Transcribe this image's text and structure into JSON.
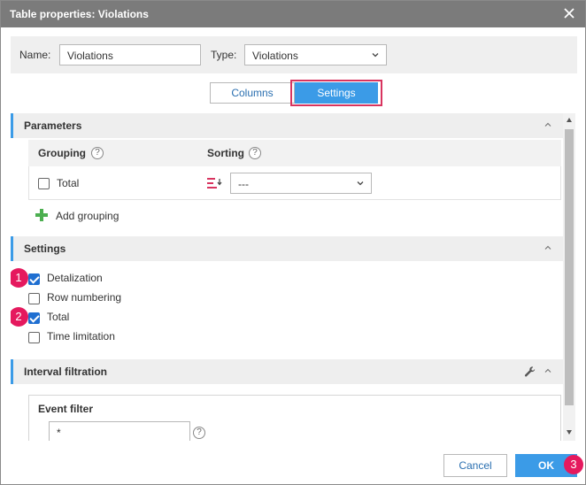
{
  "window": {
    "title": "Table properties: Violations"
  },
  "name_bar": {
    "name_label": "Name:",
    "name_value": "Violations",
    "type_label": "Type:",
    "type_value": "Violations"
  },
  "tabs": [
    {
      "label": "Columns",
      "active": false
    },
    {
      "label": "Settings",
      "active": true
    }
  ],
  "parameters": {
    "title": "Parameters",
    "grouping_header": "Grouping",
    "sorting_header": "Sorting",
    "help_glyph": "?",
    "row": {
      "checkbox_label": "Total",
      "checked": false,
      "sorting_value": "---"
    },
    "add_grouping": "Add grouping"
  },
  "settings": {
    "title": "Settings",
    "options": [
      {
        "label": "Detalization",
        "checked": true,
        "badge": "1"
      },
      {
        "label": "Row numbering",
        "checked": false,
        "badge": ""
      },
      {
        "label": "Total",
        "checked": true,
        "badge": "2"
      },
      {
        "label": "Time limitation",
        "checked": false,
        "badge": ""
      }
    ]
  },
  "interval_filtration": {
    "title": "Interval filtration",
    "event_filter_label": "Event filter",
    "event_filter_value": "*"
  },
  "footer": {
    "cancel_label": "Cancel",
    "ok_label": "OK",
    "ok_badge": "3"
  },
  "colors": {
    "accent": "#3b9be7",
    "highlight_outline": "#d8345f",
    "badge": "#e5195e",
    "add_icon": "#4caf50",
    "titlebar": "#7b7b7b"
  },
  "icons": {
    "close": "close-icon",
    "dropdown": "chevron-down-icon",
    "collapse": "chevron-up-icon",
    "sort": "sort-order-icon",
    "add": "plus-icon",
    "configure": "wrench-icon"
  }
}
